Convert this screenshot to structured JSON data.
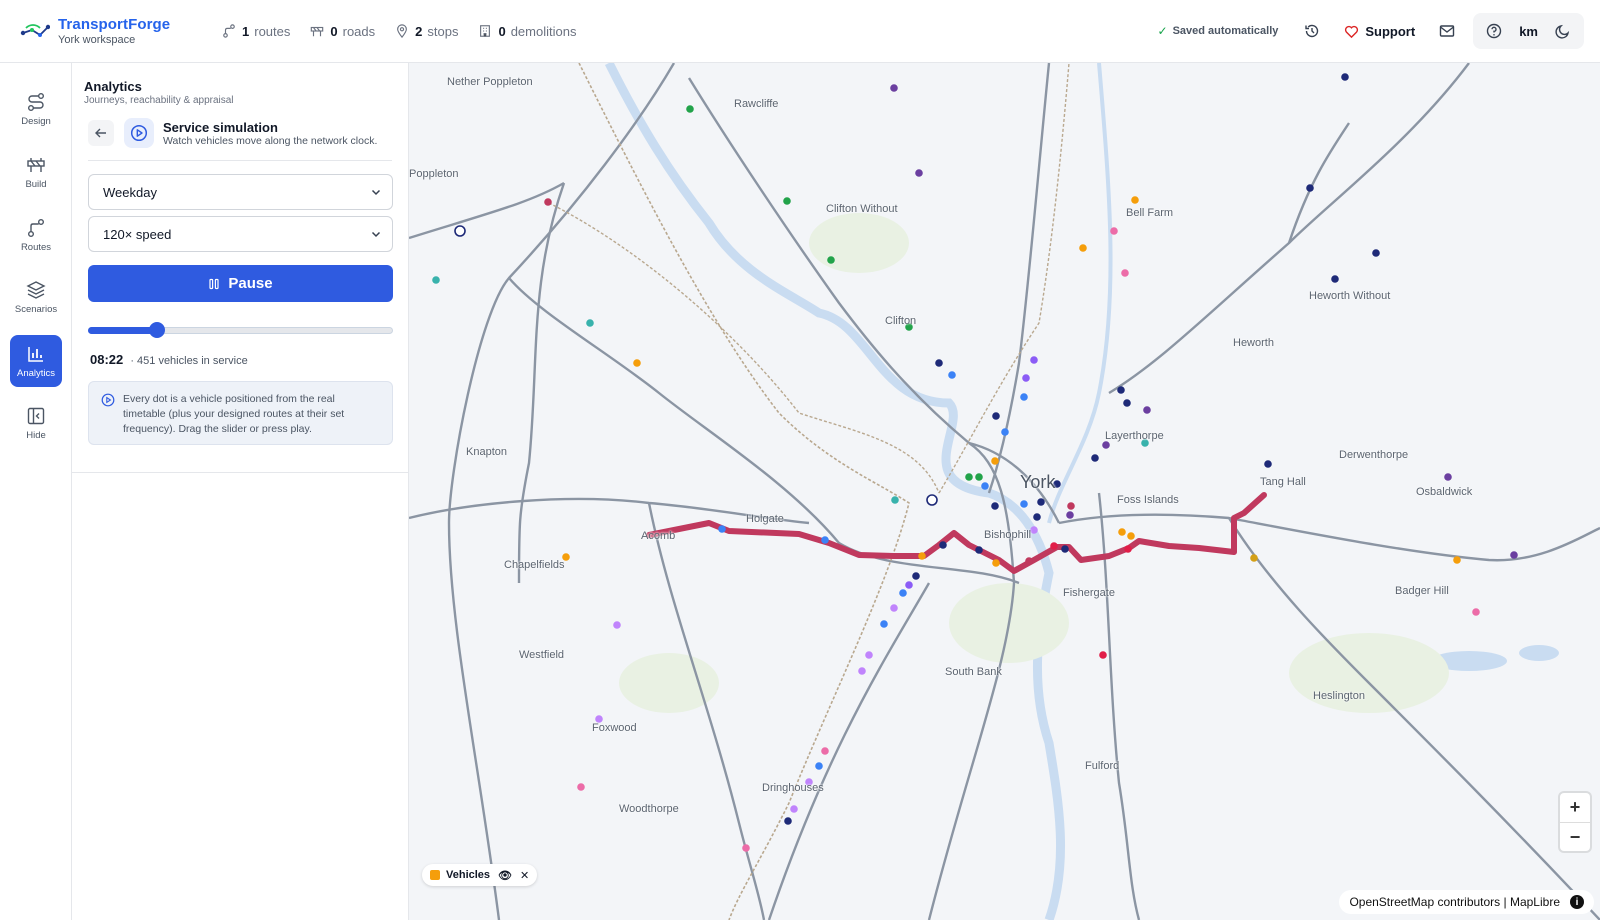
{
  "brand": {
    "name": "TransportForge",
    "workspace": "York workspace"
  },
  "stats": [
    {
      "value": "1",
      "label": "routes",
      "icon": "route-icon"
    },
    {
      "value": "0",
      "label": "roads",
      "icon": "road-barrier-icon"
    },
    {
      "value": "2",
      "label": "stops",
      "icon": "map-pin-icon"
    },
    {
      "value": "0",
      "label": "demolitions",
      "icon": "building-icon"
    }
  ],
  "header": {
    "saved": "Saved automatically",
    "support": "Support",
    "unit": "km"
  },
  "rail": [
    {
      "label": "Design",
      "icon": "design-icon"
    },
    {
      "label": "Build",
      "icon": "barrier-icon"
    },
    {
      "label": "Routes",
      "icon": "route-icon"
    },
    {
      "label": "Scenarios",
      "icon": "layers-icon"
    },
    {
      "label": "Analytics",
      "icon": "bar-chart-icon",
      "active": true
    },
    {
      "label": "Hide",
      "icon": "panel-collapse-icon"
    }
  ],
  "panel": {
    "title": "Analytics",
    "subtitle": "Journeys, reachability & appraisal",
    "sim_title": "Service simulation",
    "sim_desc": "Watch vehicles move along the network clock.",
    "day_select": "Weekday",
    "speed_select": "120× speed",
    "pause_label": "Pause",
    "slider_fraction": 0.225,
    "time": "08:22",
    "vehicles_text": "· 451 vehicles in service",
    "info": "Every dot is a vehicle positioned from the real timetable (plus your designed routes at their set frequency). Drag the slider or press play."
  },
  "map": {
    "places": {
      "nether_poppleton": "Nether Poppleton",
      "rawcliffe": "Rawcliffe",
      "poppleton": "Poppleton",
      "clifton_without": "Clifton Without",
      "bell_farm": "Bell Farm",
      "heworth_without": "Heworth Without",
      "clifton": "Clifton",
      "heworth": "Heworth",
      "layerthorpe": "Layerthorpe",
      "derwenthorpe": "Derwenthorpe",
      "knapton": "Knapton",
      "york": "York",
      "foss_islands": "Foss Islands",
      "tang_hall": "Tang Hall",
      "osbaldwick": "Osbaldwick",
      "holgate": "Holgate",
      "acomb": "Acomb",
      "bishophill": "Bishophill",
      "chapelfields": "Chapelfields",
      "fishergate": "Fishergate",
      "badger_hill": "Badger Hill",
      "westfield": "Westfield",
      "south_bank": "South Bank",
      "heslington": "Heslington",
      "foxwood": "Foxwood",
      "fulford": "Fulford",
      "dringhouses": "Dringhouses",
      "woodthorpe": "Woodthorpe"
    },
    "legend_label": "Vehicles",
    "legend_color": "#f59e0b",
    "route_color": "#c0395e",
    "attribution": "OpenStreetMap contributors | MapLibre",
    "zoom_in": "+",
    "zoom_out": "−"
  }
}
